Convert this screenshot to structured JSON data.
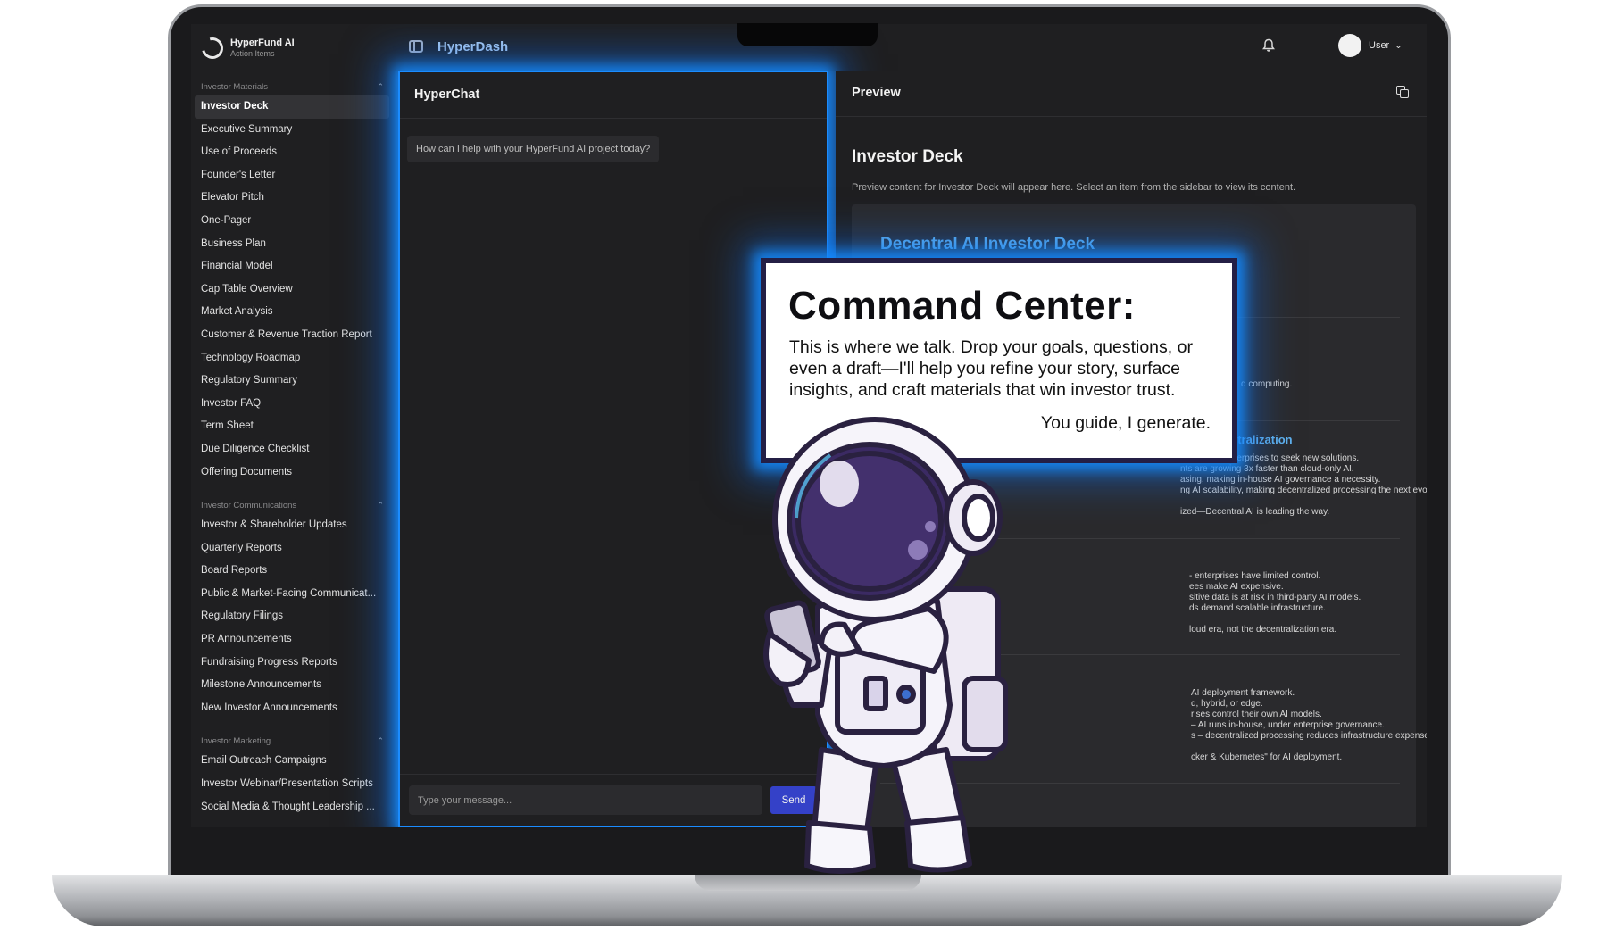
{
  "brand": {
    "name": "HyperFund AI",
    "subtitle": "Action Items"
  },
  "topbar": {
    "title": "HyperDash",
    "user_label": "User"
  },
  "sidebar": {
    "sections": [
      {
        "title": "Investor Materials",
        "items": [
          "Investor Deck",
          "Executive Summary",
          "Use of Proceeds",
          "Founder's Letter",
          "Elevator Pitch",
          "One-Pager",
          "Business Plan",
          "Financial Model",
          "Cap Table Overview",
          "Market Analysis",
          "Customer & Revenue Traction Report",
          "Technology Roadmap",
          "Regulatory Summary",
          "Investor FAQ",
          "Term Sheet",
          "Due Diligence Checklist",
          "Offering Documents"
        ]
      },
      {
        "title": "Investor Communications",
        "items": [
          "Investor & Shareholder Updates",
          "Quarterly Reports",
          "Board Reports",
          "Public & Market-Facing Communicat...",
          "Regulatory Filings",
          "PR Announcements",
          "Fundraising Progress Reports",
          "Milestone Announcements",
          "New Investor Announcements"
        ]
      },
      {
        "title": "Investor Marketing",
        "items": [
          "Email Outreach Campaigns",
          "Investor  Webinar/Presentation Scripts",
          "Social Media & Thought Leadership ..."
        ]
      }
    ],
    "active_item": "Investor Deck"
  },
  "chat": {
    "title": "HyperChat",
    "greeting": "How can I help with your HyperFund AI project today?",
    "input_placeholder": "Type your message...",
    "send_label": "Send"
  },
  "preview": {
    "title": "Preview",
    "doc_title": "Investor Deck",
    "doc_description": "Preview content for Investor Deck will appear here. Select an item from the sidebar to view its content.",
    "deck_title": "Decentral AI Investor Deck",
    "visible_fragments": {
      "s2_tail": "d computing.",
      "s3_title": "ty of AI Decentralization",
      "s3_lines": [
        "ng, forcing enterprises to seek new solutions.",
        "nts are growing 3x faster than cloud-only AI.",
        "asing, making in-house AI governance a necessity.",
        "ng AI scalability, making decentralized processing the next evolution."
      ],
      "s3_tail": "ized—Decentral AI is leading the way.",
      "s4_lines": [
        "- enterprises have limited control.",
        "ees make AI expensive.",
        "sitive data is at risk in third-party AI models.",
        "ds demand scalable infrastructure."
      ],
      "s4_tail": "loud era, not the decentralization era.",
      "s5_lines": [
        "AI deployment framework.",
        "d, hybrid, or edge.",
        "rises control their own AI models.",
        "– AI runs in-house, under enterprise governance.",
        "s – decentralized processing reduces infrastructure expenses."
      ],
      "s5_tail": "cker & Kubernetes\" for AI deployment."
    }
  },
  "callout": {
    "title": "Command Center:",
    "body": "This is where we talk. Drop your goals, questions, or even a draft—I'll help you refine your story, surface insights, and craft materials that win investor trust.",
    "sign_off": "You guide, I generate."
  },
  "colors": {
    "glow": "#1b8cff",
    "accent_blue": "#5fb0ec",
    "send_button": "#3441c8",
    "callout_border": "#241f45"
  }
}
